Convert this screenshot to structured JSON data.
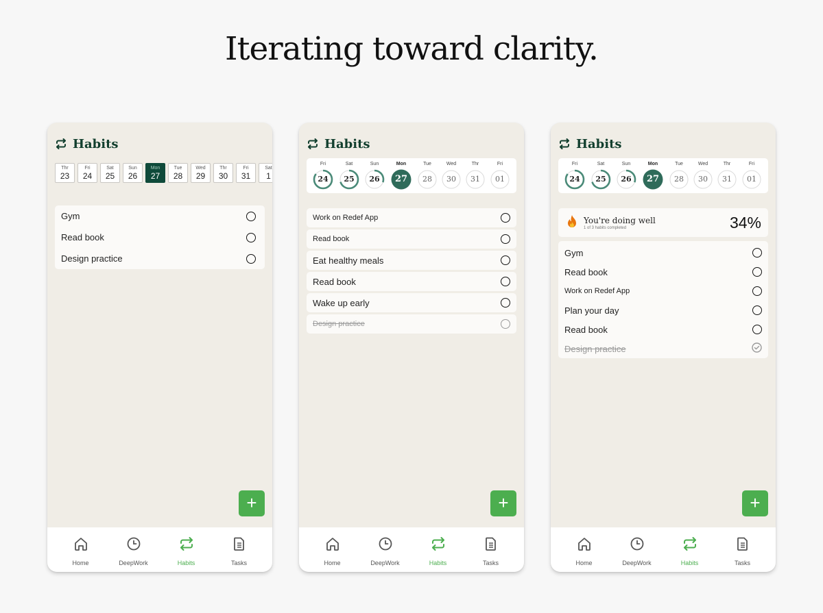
{
  "headline": "Iterating toward clarity.",
  "colors": {
    "brand_dark": "#0f4a3a",
    "accent_green": "#4cae4f",
    "ring_teal": "#4a8a78",
    "flame": "#e46b12"
  },
  "nav": [
    {
      "label": "Home",
      "icon": "home-icon"
    },
    {
      "label": "DeepWork",
      "icon": "clock-icon"
    },
    {
      "label": "Habits",
      "icon": "repeat-icon",
      "active": true
    },
    {
      "label": "Tasks",
      "icon": "document-icon"
    }
  ],
  "screens": [
    {
      "title": "Habits",
      "dates": [
        {
          "day": "Thr",
          "num": "23"
        },
        {
          "day": "Fri",
          "num": "24"
        },
        {
          "day": "Sat",
          "num": "25"
        },
        {
          "day": "Sun",
          "num": "26"
        },
        {
          "day": "Mon",
          "num": "27",
          "selected": true
        },
        {
          "day": "Tue",
          "num": "28"
        },
        {
          "day": "Wed",
          "num": "29"
        },
        {
          "day": "Thr",
          "num": "30"
        },
        {
          "day": "Fri",
          "num": "31"
        },
        {
          "day": "Sat",
          "num": "1"
        }
      ],
      "habits": [
        "Gym",
        "Read book",
        "Design practice"
      ],
      "fab": "+"
    },
    {
      "title": "Habits",
      "dates": [
        {
          "day": "Fri",
          "num": "24",
          "progress": 0.85
        },
        {
          "day": "Sat",
          "num": "25",
          "progress": 0.7
        },
        {
          "day": "Sun",
          "num": "26",
          "progress": 0.3
        },
        {
          "day": "Mon",
          "num": "27",
          "selected": true
        },
        {
          "day": "Tue",
          "num": "28"
        },
        {
          "day": "Wed",
          "num": "30"
        },
        {
          "day": "Thr",
          "num": "31"
        },
        {
          "day": "Fri",
          "num": "01"
        }
      ],
      "habits": [
        {
          "label": "Work on Redef App"
        },
        {
          "label": "Read book"
        },
        {
          "label": "Eat healthy meals",
          "big": true
        },
        {
          "label": "Read book",
          "big": true
        },
        {
          "label": "Wake up early",
          "big": true
        },
        {
          "label": "Design practice",
          "done": true
        }
      ],
      "fab": "+"
    },
    {
      "title": "Habits",
      "dates": [
        {
          "day": "Fri",
          "num": "24",
          "progress": 0.85
        },
        {
          "day": "Sat",
          "num": "25",
          "progress": 0.7
        },
        {
          "day": "Sun",
          "num": "26",
          "progress": 0.3
        },
        {
          "day": "Mon",
          "num": "27",
          "selected": true
        },
        {
          "day": "Tue",
          "num": "28"
        },
        {
          "day": "Wed",
          "num": "30"
        },
        {
          "day": "Thr",
          "num": "31"
        },
        {
          "day": "Fri",
          "num": "01"
        }
      ],
      "status": {
        "title": "You're doing well",
        "sub": "1 of 3 habits completed",
        "percent": "34%",
        "icon": "flame-icon"
      },
      "habits": [
        {
          "label": "Gym"
        },
        {
          "label": "Read book"
        },
        {
          "label": "Work on Redef App",
          "small": true
        },
        {
          "label": "Plan your day"
        },
        {
          "label": "Read book"
        },
        {
          "label": "Design practice",
          "done": true
        }
      ],
      "fab": "+"
    }
  ]
}
